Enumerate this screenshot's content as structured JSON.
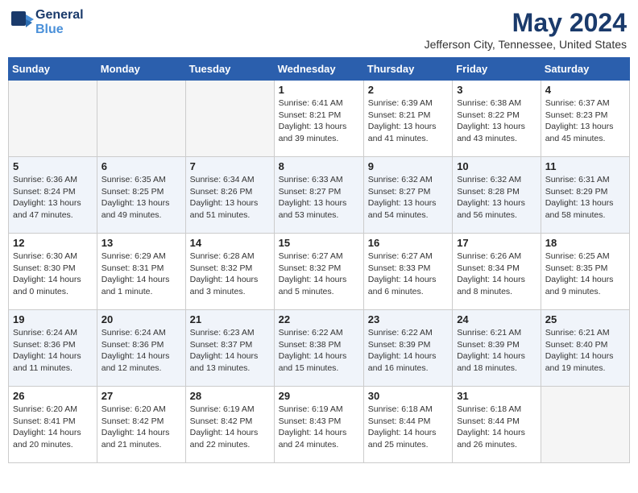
{
  "header": {
    "logo": {
      "line1": "General",
      "line2": "Blue"
    },
    "title": "May 2024",
    "location": "Jefferson City, Tennessee, United States"
  },
  "days_of_week": [
    "Sunday",
    "Monday",
    "Tuesday",
    "Wednesday",
    "Thursday",
    "Friday",
    "Saturday"
  ],
  "weeks": [
    [
      {
        "day": "",
        "info": ""
      },
      {
        "day": "",
        "info": ""
      },
      {
        "day": "",
        "info": ""
      },
      {
        "day": "1",
        "info": "Sunrise: 6:41 AM\nSunset: 8:21 PM\nDaylight: 13 hours\nand 39 minutes."
      },
      {
        "day": "2",
        "info": "Sunrise: 6:39 AM\nSunset: 8:21 PM\nDaylight: 13 hours\nand 41 minutes."
      },
      {
        "day": "3",
        "info": "Sunrise: 6:38 AM\nSunset: 8:22 PM\nDaylight: 13 hours\nand 43 minutes."
      },
      {
        "day": "4",
        "info": "Sunrise: 6:37 AM\nSunset: 8:23 PM\nDaylight: 13 hours\nand 45 minutes."
      }
    ],
    [
      {
        "day": "5",
        "info": "Sunrise: 6:36 AM\nSunset: 8:24 PM\nDaylight: 13 hours\nand 47 minutes."
      },
      {
        "day": "6",
        "info": "Sunrise: 6:35 AM\nSunset: 8:25 PM\nDaylight: 13 hours\nand 49 minutes."
      },
      {
        "day": "7",
        "info": "Sunrise: 6:34 AM\nSunset: 8:26 PM\nDaylight: 13 hours\nand 51 minutes."
      },
      {
        "day": "8",
        "info": "Sunrise: 6:33 AM\nSunset: 8:27 PM\nDaylight: 13 hours\nand 53 minutes."
      },
      {
        "day": "9",
        "info": "Sunrise: 6:32 AM\nSunset: 8:27 PM\nDaylight: 13 hours\nand 54 minutes."
      },
      {
        "day": "10",
        "info": "Sunrise: 6:32 AM\nSunset: 8:28 PM\nDaylight: 13 hours\nand 56 minutes."
      },
      {
        "day": "11",
        "info": "Sunrise: 6:31 AM\nSunset: 8:29 PM\nDaylight: 13 hours\nand 58 minutes."
      }
    ],
    [
      {
        "day": "12",
        "info": "Sunrise: 6:30 AM\nSunset: 8:30 PM\nDaylight: 14 hours\nand 0 minutes."
      },
      {
        "day": "13",
        "info": "Sunrise: 6:29 AM\nSunset: 8:31 PM\nDaylight: 14 hours\nand 1 minute."
      },
      {
        "day": "14",
        "info": "Sunrise: 6:28 AM\nSunset: 8:32 PM\nDaylight: 14 hours\nand 3 minutes."
      },
      {
        "day": "15",
        "info": "Sunrise: 6:27 AM\nSunset: 8:32 PM\nDaylight: 14 hours\nand 5 minutes."
      },
      {
        "day": "16",
        "info": "Sunrise: 6:27 AM\nSunset: 8:33 PM\nDaylight: 14 hours\nand 6 minutes."
      },
      {
        "day": "17",
        "info": "Sunrise: 6:26 AM\nSunset: 8:34 PM\nDaylight: 14 hours\nand 8 minutes."
      },
      {
        "day": "18",
        "info": "Sunrise: 6:25 AM\nSunset: 8:35 PM\nDaylight: 14 hours\nand 9 minutes."
      }
    ],
    [
      {
        "day": "19",
        "info": "Sunrise: 6:24 AM\nSunset: 8:36 PM\nDaylight: 14 hours\nand 11 minutes."
      },
      {
        "day": "20",
        "info": "Sunrise: 6:24 AM\nSunset: 8:36 PM\nDaylight: 14 hours\nand 12 minutes."
      },
      {
        "day": "21",
        "info": "Sunrise: 6:23 AM\nSunset: 8:37 PM\nDaylight: 14 hours\nand 13 minutes."
      },
      {
        "day": "22",
        "info": "Sunrise: 6:22 AM\nSunset: 8:38 PM\nDaylight: 14 hours\nand 15 minutes."
      },
      {
        "day": "23",
        "info": "Sunrise: 6:22 AM\nSunset: 8:39 PM\nDaylight: 14 hours\nand 16 minutes."
      },
      {
        "day": "24",
        "info": "Sunrise: 6:21 AM\nSunset: 8:39 PM\nDaylight: 14 hours\nand 18 minutes."
      },
      {
        "day": "25",
        "info": "Sunrise: 6:21 AM\nSunset: 8:40 PM\nDaylight: 14 hours\nand 19 minutes."
      }
    ],
    [
      {
        "day": "26",
        "info": "Sunrise: 6:20 AM\nSunset: 8:41 PM\nDaylight: 14 hours\nand 20 minutes."
      },
      {
        "day": "27",
        "info": "Sunrise: 6:20 AM\nSunset: 8:42 PM\nDaylight: 14 hours\nand 21 minutes."
      },
      {
        "day": "28",
        "info": "Sunrise: 6:19 AM\nSunset: 8:42 PM\nDaylight: 14 hours\nand 22 minutes."
      },
      {
        "day": "29",
        "info": "Sunrise: 6:19 AM\nSunset: 8:43 PM\nDaylight: 14 hours\nand 24 minutes."
      },
      {
        "day": "30",
        "info": "Sunrise: 6:18 AM\nSunset: 8:44 PM\nDaylight: 14 hours\nand 25 minutes."
      },
      {
        "day": "31",
        "info": "Sunrise: 6:18 AM\nSunset: 8:44 PM\nDaylight: 14 hours\nand 26 minutes."
      },
      {
        "day": "",
        "info": ""
      }
    ]
  ]
}
